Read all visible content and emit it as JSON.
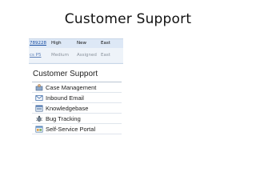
{
  "slide": {
    "title": "Customer Support"
  },
  "grid": {
    "rows": [
      {
        "id": "789228",
        "priority": "High",
        "status": "New",
        "region": "East"
      },
      {
        "id": "cs P5",
        "priority": "Medium",
        "status": "Assigned",
        "region": "East"
      }
    ]
  },
  "panel": {
    "header": "Customer Support",
    "items": [
      {
        "label": "Case Management",
        "icon": "case-management-icon"
      },
      {
        "label": "Inbound Email",
        "icon": "email-icon"
      },
      {
        "label": "Knowledgebase",
        "icon": "knowledgebase-icon"
      },
      {
        "label": "Bug Tracking",
        "icon": "bug-icon"
      },
      {
        "label": "Self-Service Portal",
        "icon": "portal-icon"
      }
    ]
  },
  "colors": {
    "link": "#1a4fa3",
    "grid_bg": "#e9eff7",
    "divider": "#b9c4d2"
  }
}
